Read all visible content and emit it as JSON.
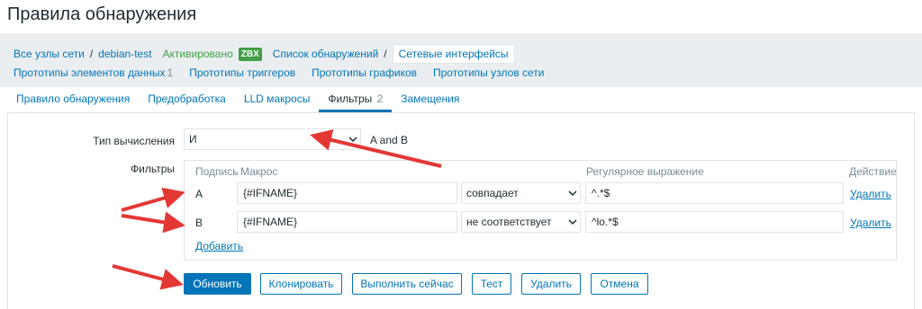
{
  "page": {
    "title": "Правила обнаружения"
  },
  "breadcrumbs": {
    "all_hosts": "Все узлы сети",
    "host": "debian-test",
    "status": "Активировано",
    "badge": "ZBX",
    "discovery_list": "Список обнаружений",
    "current": "Сетевые интерфейсы"
  },
  "subnav": [
    {
      "label": "Прототипы элементов данных",
      "count": "1"
    },
    {
      "label": "Прототипы триггеров",
      "count": ""
    },
    {
      "label": "Прототипы графиков",
      "count": ""
    },
    {
      "label": "Прототипы узлов сети",
      "count": ""
    }
  ],
  "tabs": [
    {
      "label": "Правило обнаружения",
      "count": ""
    },
    {
      "label": "Предобработка",
      "count": ""
    },
    {
      "label": "LLD макросы",
      "count": ""
    },
    {
      "label": "Фильтры",
      "count": "2"
    },
    {
      "label": "Замещения",
      "count": ""
    }
  ],
  "form": {
    "calc_label": "Тип вычисления",
    "calc_value": "И",
    "calc_formula": "A and B",
    "filters_label": "Фильтры",
    "columns": {
      "label": "Подпись",
      "macro": "Макрос",
      "regex": "Регулярное выражение",
      "action": "Действие"
    },
    "rows": [
      {
        "label": "A",
        "macro": "{#IFNAME}",
        "operator": "совпадает",
        "regex": "^.*$",
        "action": "Удалить"
      },
      {
        "label": "B",
        "macro": "{#IFNAME}",
        "operator": "не соответствует",
        "regex": "^lo.*$",
        "action": "Удалить"
      }
    ],
    "add_label": "Добавить"
  },
  "buttons": {
    "update": "Обновить",
    "clone": "Клонировать",
    "execute": "Выполнить сейчас",
    "test": "Тест",
    "delete": "Удалить",
    "cancel": "Отмена"
  },
  "colors": {
    "link": "#0275b8",
    "active_green": "#429e47",
    "annotation_arrow": "#e33734",
    "nav_bg": "#ebeef0"
  }
}
